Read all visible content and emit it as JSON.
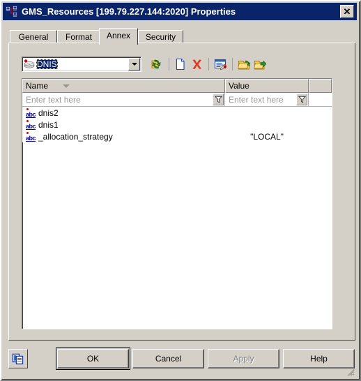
{
  "window": {
    "title": "GMS_Resources [199.79.227.144:2020] Properties",
    "title_icon": "network-resource-icon",
    "close_label": "✕"
  },
  "tabs": [
    {
      "label": "General",
      "active": false
    },
    {
      "label": "Format",
      "active": false
    },
    {
      "label": "Annex",
      "active": true
    },
    {
      "label": "Security",
      "active": false
    }
  ],
  "toolbar": {
    "section_combo": {
      "icon": "section-stack-icon",
      "value": "DNIS",
      "selected": true,
      "arrow": "chevron-down-icon"
    },
    "buttons": [
      {
        "name": "refresh-button",
        "icon": "yellow-refresh-arrow-icon"
      },
      {
        "name": "new-section-button",
        "icon": "new-document-icon"
      },
      {
        "name": "delete-button",
        "icon": "red-x-delete-icon"
      },
      {
        "name": "edit-option-button",
        "icon": "edit-note-icon"
      },
      {
        "name": "import-button",
        "icon": "folder-import-icon"
      },
      {
        "name": "export-button",
        "icon": "folder-export-icon"
      }
    ]
  },
  "grid": {
    "columns": [
      {
        "label": "Name",
        "sorted": true,
        "sort_direction": "descending"
      },
      {
        "label": "Value",
        "sorted": false
      },
      {
        "label": "",
        "sorted": false
      }
    ],
    "filter_placeholder": "Enter text here",
    "filter_icon": "funnel-filter-icon",
    "row_icon": "abc-string-option-icon",
    "rows": [
      {
        "name": "dnis2",
        "value": ""
      },
      {
        "name": "dnis1",
        "value": ""
      },
      {
        "name": "_allocation_strategy",
        "value": "\"LOCAL\""
      }
    ]
  },
  "footer": {
    "copy_button_icon": "copy-pages-icon",
    "buttons": [
      {
        "label": "OK",
        "default": true,
        "disabled": false
      },
      {
        "label": "Cancel",
        "default": false,
        "disabled": false
      },
      {
        "label": "Apply",
        "default": false,
        "disabled": true,
        "accesskey": "A"
      },
      {
        "label": "Help",
        "default": false,
        "disabled": false
      }
    ],
    "resize_grip": "resize-grip-icon"
  },
  "colors": {
    "titlebar": "#0a246a",
    "face": "#d4d0c8",
    "grid_background": "#ffffff",
    "placeholder_text": "#9a9a9a",
    "accent_red": "#d40000",
    "accent_blue": "#00008b"
  }
}
